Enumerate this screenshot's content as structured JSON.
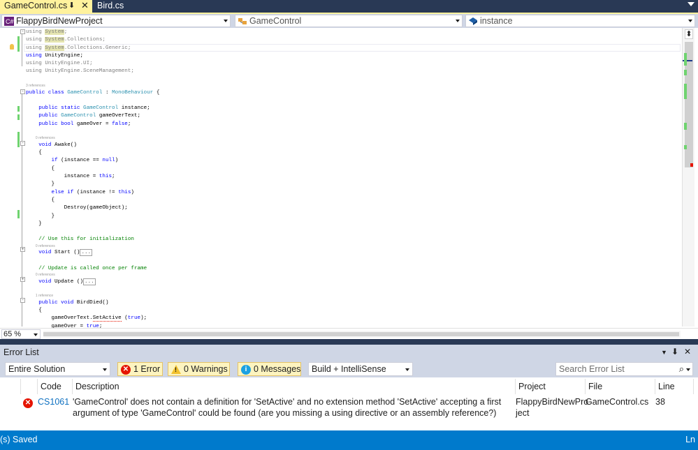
{
  "tabs": [
    {
      "label": "GameControl.cs",
      "active": true
    },
    {
      "label": "Bird.cs",
      "active": false
    }
  ],
  "nav": {
    "project": "FlappyBirdNewProject",
    "class": "GameControl",
    "member": "instance"
  },
  "code": {
    "l1": "using System;",
    "l2": "using System.Collections;",
    "l3": "using System.Collections.Generic;",
    "l4": "using UnityEngine;",
    "l5": "using UnityEngine.UI;",
    "l6": "using UnityEngine.SceneManagement;",
    "ref3": "3 references",
    "ref0a": "0 references",
    "ref0b": "0 references",
    "ref0c": "0 references",
    "ref1": "1 reference",
    "comment_start": "// Use this for initialization",
    "comment_update": "// Update is called once per frame",
    "collapsed": "..."
  },
  "zoom": "65 %",
  "errorList": {
    "title": "Error List",
    "scope": "Entire Solution",
    "errors_btn": "1 Error",
    "warnings_btn": "0 Warnings",
    "messages_btn": "0 Messages",
    "source": "Build + IntelliSense",
    "search_placeholder": "Search Error List",
    "columns": {
      "code": "Code",
      "description": "Description",
      "project": "Project",
      "file": "File",
      "line": "Line"
    },
    "rows": [
      {
        "code": "CS1061",
        "description_1": "'GameControl' does not contain a definition for 'SetActive' and no extension method 'SetActive' accepting a first",
        "description_2": "argument of type 'GameControl' could be found (are you missing a using directive or an assembly reference?)",
        "project_1": "FlappyBirdNewPro",
        "project_2": "ject",
        "file": "GameControl.cs",
        "line": "38"
      }
    ]
  },
  "status": {
    "text": "(s) Saved",
    "right": "Ln"
  },
  "colors": {
    "activeTab": "#fff29d",
    "chrome": "#293955",
    "statusbar": "#007acc",
    "error": "#e51400",
    "changeMarker": "#6fd36f"
  }
}
